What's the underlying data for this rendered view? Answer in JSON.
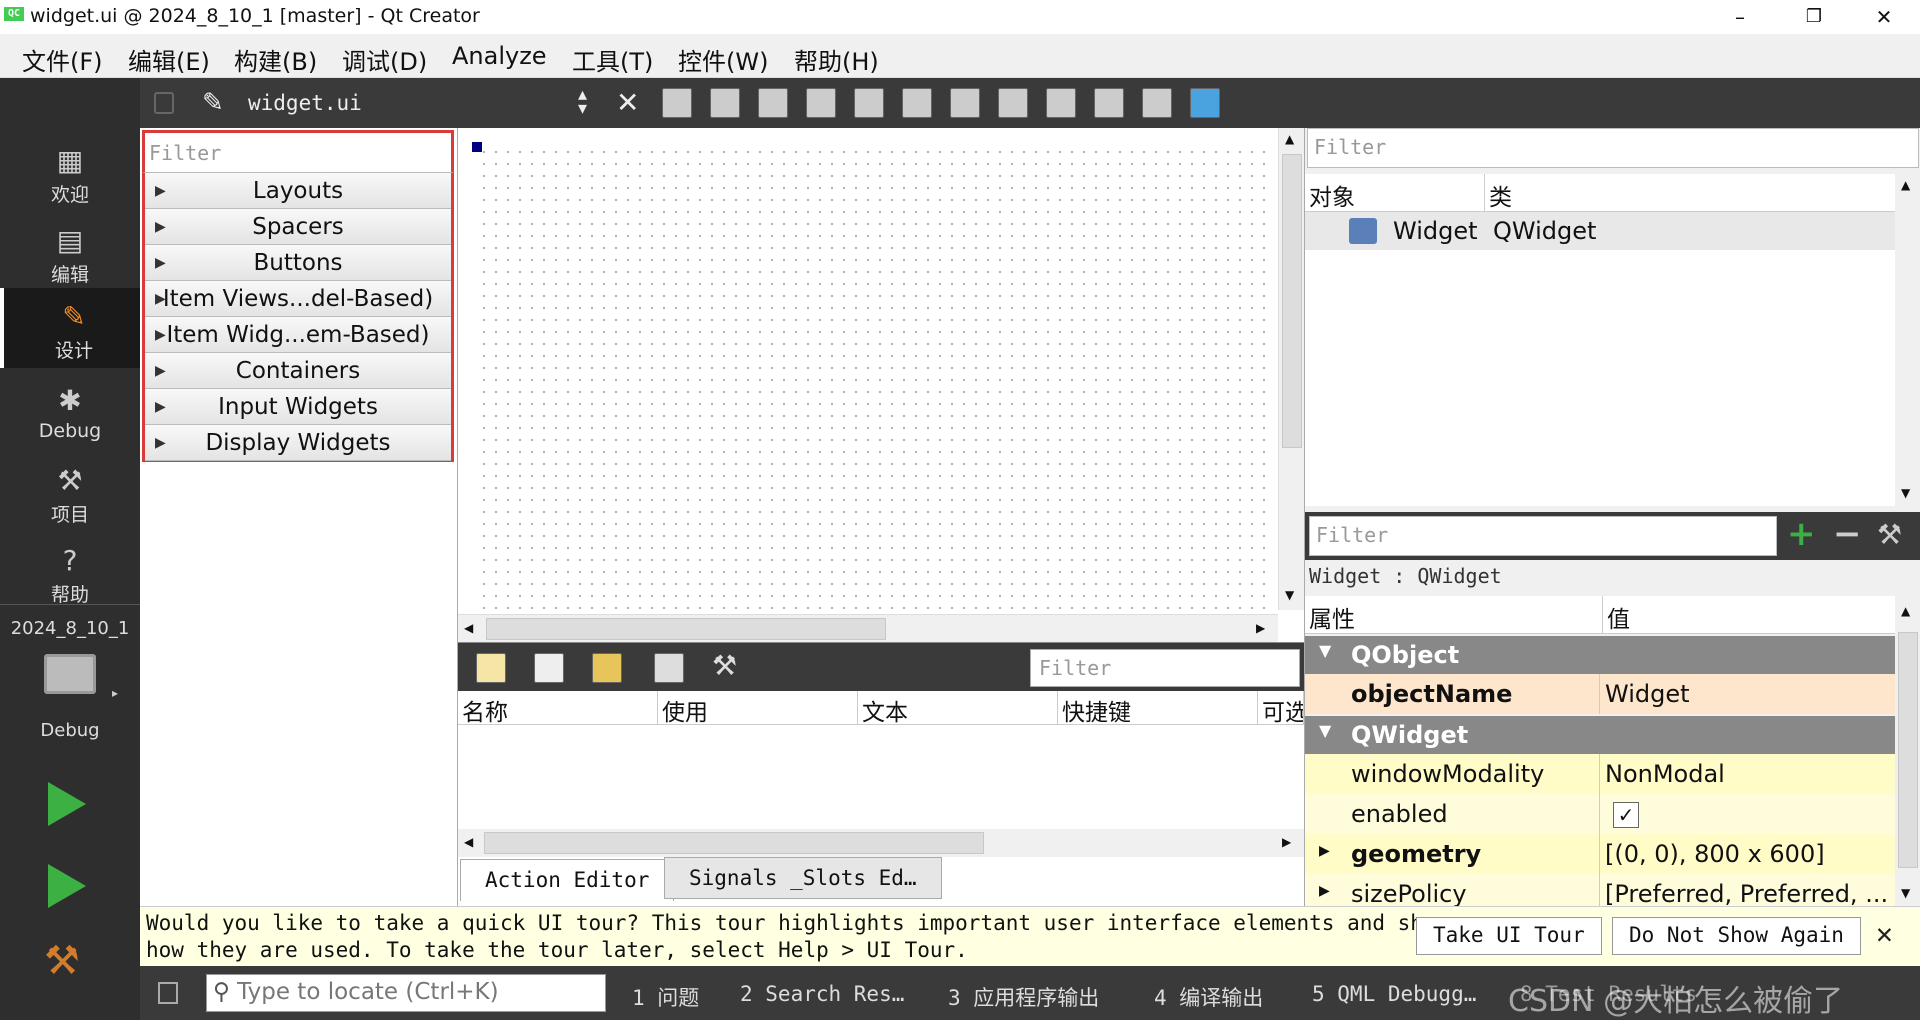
{
  "window": {
    "title": "widget.ui @ 2024_8_10_1 [master] - Qt Creator",
    "logo": "QC",
    "controls": [
      "–",
      "❐",
      "✕"
    ]
  },
  "menu": [
    "文件(F)",
    "编辑(E)",
    "构建(B)",
    "调试(D)",
    "Analyze",
    "工具(T)",
    "控件(W)",
    "帮助(H)"
  ],
  "modes": [
    {
      "icon": "grid-icon",
      "label": "欢迎"
    },
    {
      "icon": "document-icon",
      "label": "编辑"
    },
    {
      "icon": "pencil-icon",
      "label": "设计"
    },
    {
      "icon": "bug-icon",
      "label": "Debug"
    },
    {
      "icon": "wrench-icon",
      "label": "项目"
    },
    {
      "icon": "help-icon",
      "label": "帮助"
    }
  ],
  "kit": {
    "project": "2024_8_10_1",
    "mode": "Debug"
  },
  "editor": {
    "file": "widget.ui"
  },
  "widget_box": {
    "filter_placeholder": "Filter",
    "categories": [
      "Layouts",
      "Spacers",
      "Buttons",
      "Item Views...del-Based)",
      "Item Widg...em-Based)",
      "Containers",
      "Input Widgets",
      "Display Widgets"
    ]
  },
  "action_editor": {
    "filter_placeholder": "Filter",
    "columns": [
      "名称",
      "使用",
      "文本",
      "快捷键",
      "可选"
    ],
    "tabs": [
      "Action Editor",
      "Signals _Slots Ed…"
    ]
  },
  "object_inspector": {
    "filter_placeholder": "Filter",
    "columns": [
      "对象",
      "类"
    ],
    "rows": [
      {
        "object": "Widget",
        "class": "QWidget"
      }
    ]
  },
  "property_editor": {
    "filter_placeholder": "Filter",
    "context": "Widget : QWidget",
    "columns": [
      "属性",
      "值"
    ],
    "groups": [
      {
        "name": "QObject",
        "props": [
          {
            "name": "objectName",
            "value": "Widget",
            "bold": true
          }
        ]
      },
      {
        "name": "QWidget",
        "props": [
          {
            "name": "windowModality",
            "value": "NonModal",
            "bold": false
          },
          {
            "name": "enabled",
            "value": "✓",
            "bold": false
          },
          {
            "name": "geometry",
            "value": "[(0, 0), 800 x 600]",
            "bold": true
          },
          {
            "name": "sizePolicy",
            "value": "[Preferred, Preferred, ...",
            "bold": false
          }
        ]
      }
    ]
  },
  "notice": {
    "line1": "Would you like to take a quick UI tour? This tour highlights important user interface elements and shows",
    "line2": "how they are used. To take the tour later, select Help > UI Tour.",
    "take_tour": "Take UI Tour",
    "dont_show": "Do Not Show Again"
  },
  "statusbar": {
    "locate_placeholder": "Type to locate (Ctrl+K)",
    "panes": [
      "1  问题",
      "2  Search Res…",
      "3  应用程序输出",
      "4  编译输出",
      "5  QML Debugg…",
      "8  Test Results"
    ],
    "watermark": "CSDN @大柏怎么被偷了"
  }
}
